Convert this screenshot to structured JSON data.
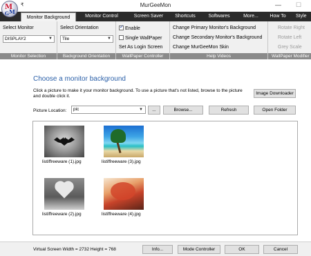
{
  "window": {
    "title": "MurGeeMon",
    "qat_glyph": "₹",
    "minimize_glyph": "—",
    "maximize_glyph": "☐"
  },
  "tabs": [
    {
      "label": "Monitor Background",
      "active": true
    },
    {
      "label": "Monitor Control",
      "active": false
    },
    {
      "label": "Screen Saver",
      "active": false
    },
    {
      "label": "Shortcuts",
      "active": false
    },
    {
      "label": "Softwares",
      "active": false
    },
    {
      "label": "More...",
      "active": false
    },
    {
      "label": "How To",
      "active": false
    },
    {
      "label": "Style",
      "active": false
    }
  ],
  "ribbon": {
    "monitor_selection": {
      "label": "Select Monitor",
      "value": "DISPLAY2",
      "caption": "Monitor Selection"
    },
    "background_orientation": {
      "label": "Select Orientation",
      "value": "Tile",
      "caption": "Background Orientation"
    },
    "wallpaper_controller": {
      "enable": {
        "label": "Enable",
        "checked": true
      },
      "single_wallpaper": {
        "label": "Single WallPaper",
        "checked": false
      },
      "login_screen": "Set As Login Screen",
      "caption": "WallPaper Controller"
    },
    "help_videos": {
      "primary": "Change Primary Monitor's Background",
      "secondary": "Change Secondary Monitor's Background",
      "skin": "Change MurGeeMon Skin",
      "caption": "Help Videos"
    },
    "wallpaper_modifier": {
      "rotate_right": "Rotate Right",
      "rotate_left": "Rotate Left",
      "grey_scale": "Grey Scale",
      "caption": "WallPaper Modifier"
    }
  },
  "main": {
    "heading": "Choose a monitor background",
    "description": "Click a picture to make it your monitor background. To use a picture that's not listed, browse to the picture and double click it.",
    "image_downloader": "Image Downloader",
    "picture_location_label": "Picture Location:",
    "picture_location_value": "pic",
    "ellipsis_button": "...",
    "browse_button": "Browse...",
    "refresh_button": "Refresh",
    "open_folder_button": "Open Folder",
    "thumbnails": [
      {
        "caption": "listiffreeware (1).jpg",
        "image": "batman-logo"
      },
      {
        "caption": "listiffreeware (3).jpg",
        "image": "tropical-beach"
      },
      {
        "caption": "listiffreeware (2).jpg",
        "image": "water-heart"
      },
      {
        "caption": "listiffreeware (4).jpg",
        "image": "autumn-trees"
      }
    ]
  },
  "status": {
    "screen_info": "Virtual Screen Width = 2732 Height = 768",
    "info_button": "Info...",
    "mode_controller_button": "Mode Controller",
    "ok_button": "OK",
    "cancel_button": "Cancel"
  }
}
